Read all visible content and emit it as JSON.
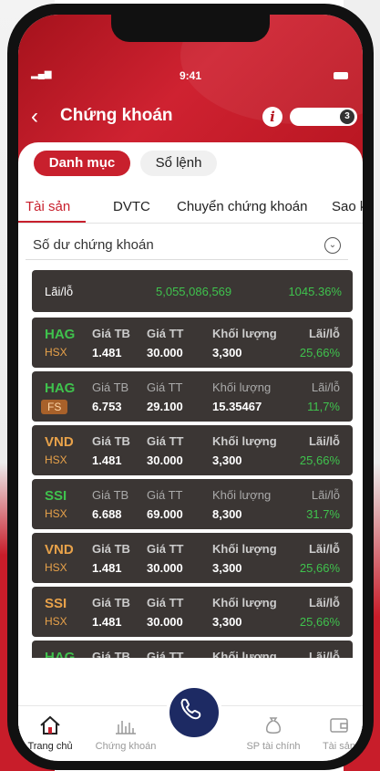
{
  "status_bar": {
    "time": "9:41"
  },
  "header": {
    "title": "Chứng khoán",
    "badge_count": "3"
  },
  "segments": [
    {
      "label": "Danh mục"
    },
    {
      "label": "Sổ lệnh"
    }
  ],
  "tabs": [
    {
      "label": "Tài sản"
    },
    {
      "label": "DVTC"
    },
    {
      "label": "Chuyển chứng khoán"
    },
    {
      "label": "Sao kê"
    }
  ],
  "section": {
    "title": "Số dư chứng khoán"
  },
  "summary": {
    "label": "Lãi/lỗ",
    "amount": "5,055,086,569",
    "percent": "1045.36%"
  },
  "columns": {
    "avg_price": "Giá TB",
    "market_price": "Giá TT",
    "volume": "Khối lượng",
    "pnl": "Lãi/lỗ"
  },
  "holdings": [
    {
      "symbol": "HAG",
      "exchange": "HSX",
      "avg": "1.481",
      "market": "30.000",
      "volume": "3,300",
      "pnl": "25,66%",
      "symbol_color": "#3fc24d",
      "header_bold": true
    },
    {
      "symbol": "HAG",
      "exchange": "FS",
      "avg": "6.753",
      "market": "29.100",
      "volume": "15.35467",
      "pnl": "11,7%",
      "symbol_color": "#3fc24d",
      "header_bold": false
    },
    {
      "symbol": "VND",
      "exchange": "HSX",
      "avg": "1.481",
      "market": "30.000",
      "volume": "3,300",
      "pnl": "25,66%",
      "symbol_color": "#e8a24a",
      "header_bold": true
    },
    {
      "symbol": "SSI",
      "exchange": "HSX",
      "avg": "6.688",
      "market": "69.000",
      "volume": "8,300",
      "pnl": "31.7%",
      "symbol_color": "#3fc24d",
      "header_bold": false
    },
    {
      "symbol": "VND",
      "exchange": "HSX",
      "avg": "1.481",
      "market": "30.000",
      "volume": "3,300",
      "pnl": "25,66%",
      "symbol_color": "#e8a24a",
      "header_bold": true
    },
    {
      "symbol": "SSI",
      "exchange": "HSX",
      "avg": "1.481",
      "market": "30.000",
      "volume": "3,300",
      "pnl": "25,66%",
      "symbol_color": "#e8a24a",
      "header_bold": true
    },
    {
      "symbol": "HAG",
      "exchange": "",
      "avg": "",
      "market": "",
      "volume": "",
      "pnl": "",
      "symbol_color": "#3fc24d",
      "header_bold": true
    }
  ],
  "bottom_nav": [
    {
      "label": "Trang chủ",
      "icon": "home-icon"
    },
    {
      "label": "Chứng khoán",
      "icon": "chart-icon"
    },
    {
      "label": "",
      "icon": "phone-icon"
    },
    {
      "label": "SP tài chính",
      "icon": "money-bag-icon"
    },
    {
      "label": "Tài sản",
      "icon": "wallet-icon"
    }
  ],
  "colors": {
    "brand_red": "#c8202d",
    "gain_green": "#3fc24d",
    "card_bg": "#3b3634",
    "call_button": "#1d2a63"
  }
}
